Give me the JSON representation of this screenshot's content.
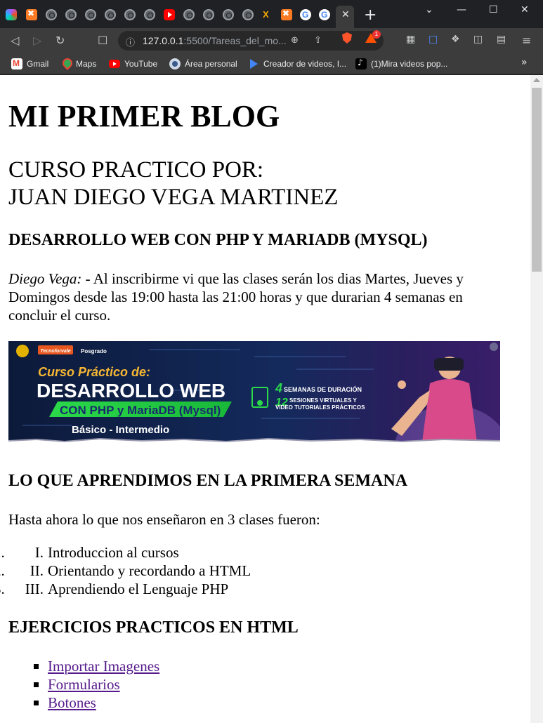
{
  "browser": {
    "tabs": {
      "active_close_glyph": "✕",
      "new_tab_glyph": "+"
    },
    "window_controls": {
      "tab_search": "⌄",
      "minimize": "—",
      "maximize": "☐",
      "close": "✕"
    },
    "toolbar": {
      "back": "◁",
      "forward": "▷",
      "reload": "↻",
      "bookmark": "☐",
      "url_host": "127.0.0.1",
      "url_rest": ":5500/Tareas_del_mo...",
      "zoom_glyph": "⊕",
      "share_glyph": "⇧",
      "rewards_badge": "1",
      "menu_glyph": "≡"
    },
    "bookmarks": [
      {
        "label": "Gmail",
        "icon": "gmail-icon"
      },
      {
        "label": "Maps",
        "icon": "maps-icon"
      },
      {
        "label": "YouTube",
        "icon": "youtube-icon"
      },
      {
        "label": "Área personal",
        "icon": "area-personal-icon"
      },
      {
        "label": "Creador de videos, I...",
        "icon": "video-creator-icon"
      },
      {
        "label": "(1)Mira videos pop...",
        "icon": "tiktok-icon"
      }
    ],
    "bookmarks_more": "»"
  },
  "page": {
    "title": "MI PRIMER BLOG",
    "subtitle_line1": "CURSO PRACTICO POR:",
    "subtitle_line2": "JUAN DIEGO VEGA MARTINEZ",
    "course_heading": "DESARROLLO WEB CON PHP Y MARIADB (MYSQL)",
    "intro_author": "Diego Vega:",
    "intro_text": " - Al inscribirme vi que las clases serán los dias Martes, Jueves y Domingos desde las 19:00 hasta las 21:00 horas y que durarian 4 semanas en concluir el curso.",
    "banner": {
      "top_logo_text": "Tecnoforvale",
      "posgrado": "Posgrado",
      "line1": "Curso Práctico de:",
      "line2": "DESARROLLO WEB",
      "line3": "CON PHP y MariaDB (Mysql)",
      "line4": "Básico - Intermedio",
      "weeks_number": "4",
      "weeks_text": "SEMANAS DE DURACIÓN",
      "sessions_number": "12",
      "sessions_text1": "SESIONES VIRTUALES Y",
      "sessions_text2": "VIDEO TUTORIALES PRÁCTICOS"
    },
    "week_heading": "LO QUE APRENDIMOS EN LA PRIMERA SEMANA",
    "week_intro": "Hasta ahora lo que nos enseñaron en 3 clases fueron:",
    "week_items": [
      {
        "marker": "I.",
        "text": "Introduccion al cursos"
      },
      {
        "marker": "II.",
        "text": "Orientando y recordando a HTML"
      },
      {
        "marker": "III.",
        "text": "Aprendiendo el Lenguaje PHP"
      }
    ],
    "exercises_heading": "EJERCICIOS PRACTICOS EN HTML",
    "exercise_links": [
      {
        "text": "Importar Imagenes"
      },
      {
        "text": "Formularios"
      },
      {
        "text": "Botones"
      }
    ]
  }
}
